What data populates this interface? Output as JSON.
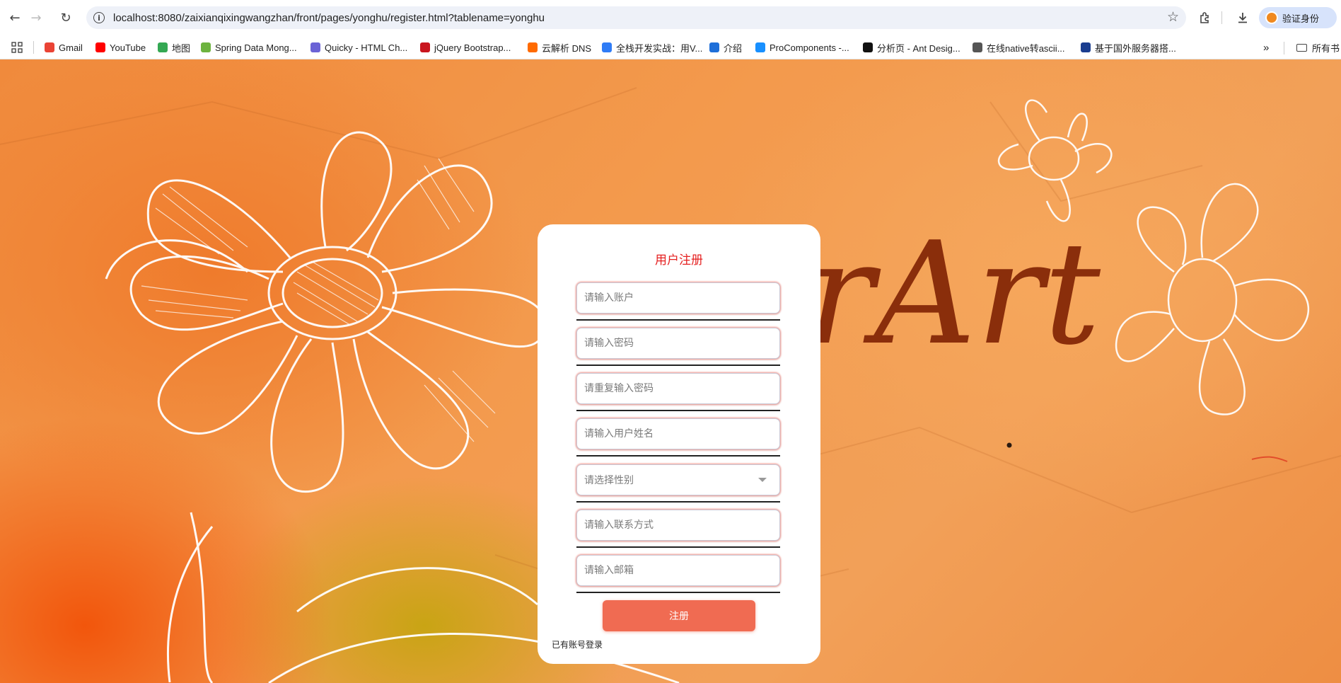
{
  "browser": {
    "url": "localhost:8080/zaixianqixingwangzhan/front/pages/yonghu/register.html?tablename=yonghu",
    "verify_label": "验证身份",
    "all_bookmarks_label": "所有书",
    "bookmarks": [
      {
        "label": "Gmail",
        "icon": "gmail-icon",
        "color": "#ea4335"
      },
      {
        "label": "YouTube",
        "icon": "youtube-icon",
        "color": "#ff0000"
      },
      {
        "label": "地图",
        "icon": "maps-icon",
        "color": "#34a853"
      },
      {
        "label": "Spring Data Mong...",
        "icon": "spring-icon",
        "color": "#6db33f"
      },
      {
        "label": "Quicky - HTML Ch...",
        "icon": "quicky-icon",
        "color": "#6b63d6"
      },
      {
        "label": "jQuery Bootstrap...",
        "icon": "jquery-icon",
        "color": "#c9151e"
      },
      {
        "label": "云解析 DNS",
        "icon": "aliyun-icon",
        "color": "#ff6a00"
      },
      {
        "label": "全栈开发实战：用V...",
        "icon": "fullstack-icon",
        "color": "#2f7cf6"
      },
      {
        "label": "介绍",
        "icon": "intro-icon",
        "color": "#1e6fd9"
      },
      {
        "label": "ProComponents -...",
        "icon": "procomponents-icon",
        "color": "#1890ff"
      },
      {
        "label": "分析页 - Ant Desig...",
        "icon": "pro-icon",
        "color": "#111111"
      },
      {
        "label": "在线native转ascii...",
        "icon": "globe-icon",
        "color": "#555555"
      },
      {
        "label": "基于国外服务器搭...",
        "icon": "server-icon",
        "color": "#1a3d8f"
      }
    ]
  },
  "background": {
    "art_text": "rArt"
  },
  "form": {
    "title": "用户注册",
    "account_placeholder": "请输入账户",
    "password_placeholder": "请输入密码",
    "repassword_placeholder": "请重复输入密码",
    "name_placeholder": "请输入用户姓名",
    "gender_placeholder": "请选择性别",
    "phone_placeholder": "请输入联系方式",
    "email_placeholder": "请输入邮箱",
    "submit_label": "注册",
    "login_link": "已有账号登录"
  }
}
